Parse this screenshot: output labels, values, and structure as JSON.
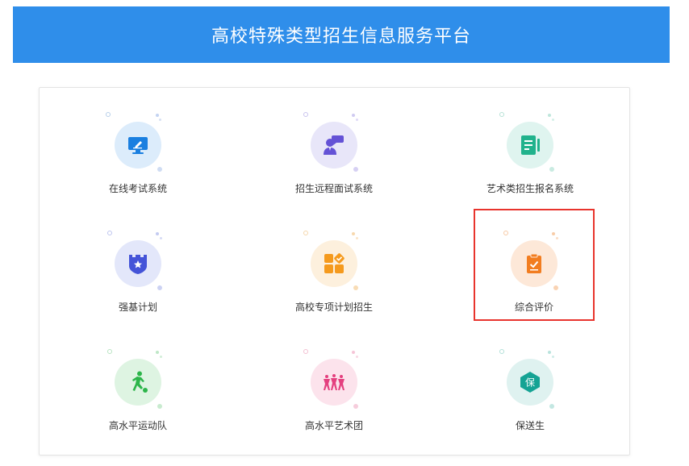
{
  "header": {
    "title": "高校特殊类型招生信息服务平台",
    "bg_color": "#2f8eea"
  },
  "tiles": [
    {
      "label": "在线考试系统",
      "icon": "monitor-edit-icon",
      "circle_color": "#dcecfb",
      "icon_color": "#1a7fe0"
    },
    {
      "label": "招生远程面试系统",
      "icon": "interview-person-icon",
      "circle_color": "#e8e6f9",
      "icon_color": "#6452d6"
    },
    {
      "label": "艺术类招生报名系统",
      "icon": "form-document-icon",
      "circle_color": "#dff4ef",
      "icon_color": "#21b28c"
    },
    {
      "label": "强基计划",
      "icon": "castle-shield-icon",
      "circle_color": "#e3e7fa",
      "icon_color": "#4454d8"
    },
    {
      "label": "高校专项计划招生",
      "icon": "grid-apps-icon",
      "circle_color": "#fdf0dd",
      "icon_color": "#f59a1d"
    },
    {
      "label": "综合评价",
      "icon": "clipboard-check-icon",
      "circle_color": "#fde8d8",
      "icon_color": "#f27d20",
      "highlighted": true
    },
    {
      "label": "高水平运动队",
      "icon": "soccer-player-icon",
      "circle_color": "#def4e2",
      "icon_color": "#2cb54a"
    },
    {
      "label": "高水平艺术团",
      "icon": "dancers-icon",
      "circle_color": "#fce3ec",
      "icon_color": "#e4407f"
    },
    {
      "label": "保送生",
      "icon": "hexagon-badge-icon",
      "circle_color": "#dff2f0",
      "icon_color": "#15a394",
      "glyph": "保"
    }
  ]
}
